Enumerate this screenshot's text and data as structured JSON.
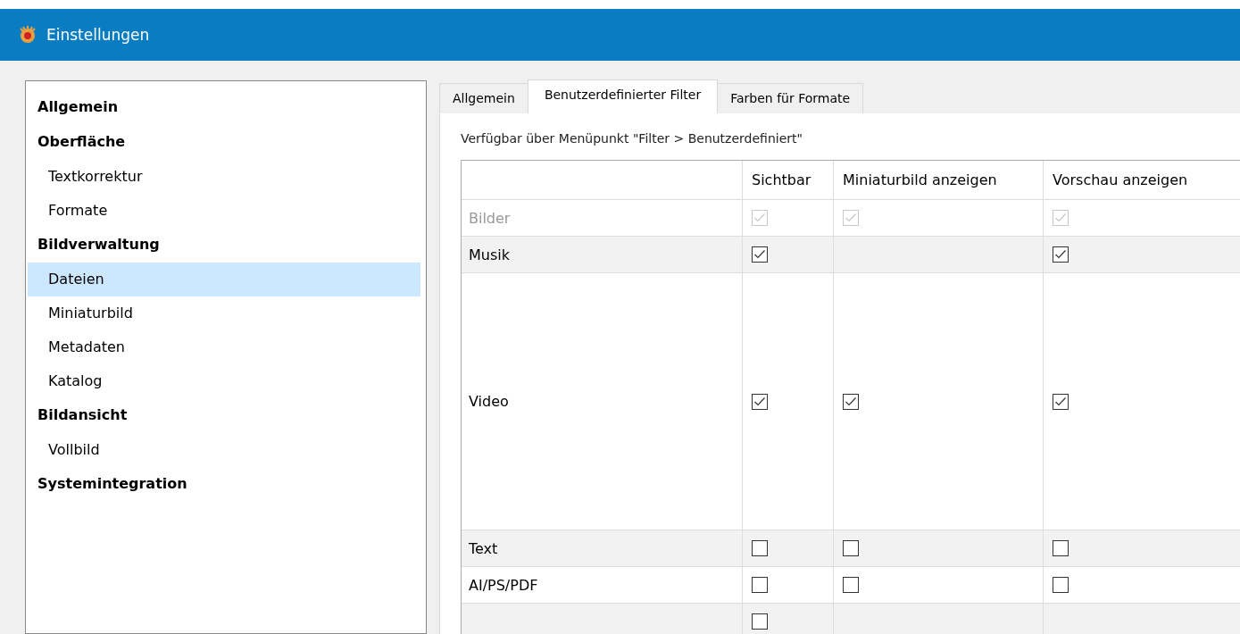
{
  "window": {
    "title": "Einstellungen"
  },
  "sidebar": {
    "items": [
      {
        "label": "Allgemein",
        "selected": false
      },
      {
        "label": "Oberfläche",
        "selected": false,
        "children": [
          {
            "label": "Textkorrektur",
            "selected": false
          },
          {
            "label": "Formate",
            "selected": false
          }
        ]
      },
      {
        "label": "Bildverwaltung",
        "selected": false,
        "children": [
          {
            "label": "Dateien",
            "selected": true
          },
          {
            "label": "Miniaturbild",
            "selected": false
          },
          {
            "label": "Metadaten",
            "selected": false
          },
          {
            "label": "Katalog",
            "selected": false
          }
        ]
      },
      {
        "label": "Bildansicht",
        "selected": false,
        "children": [
          {
            "label": "Vollbild",
            "selected": false
          }
        ]
      },
      {
        "label": "Systemintegration",
        "selected": false
      }
    ]
  },
  "tabs": [
    {
      "label": "Allgemein",
      "selected": false
    },
    {
      "label": "Benutzerdefinierter Filter",
      "selected": true
    },
    {
      "label": "Farben für Formate",
      "selected": false
    }
  ],
  "description": "Verfügbar über Menüpunkt \"Filter > Benutzerdefiniert\"",
  "table": {
    "columns": [
      "Sichtbar",
      "Miniaturbild anzeigen",
      "Vorschau anzeigen"
    ],
    "rows": [
      {
        "label": "Bilder",
        "disabled": true,
        "cells": [
          {
            "kind": "checkbox",
            "checked": true
          },
          {
            "kind": "checkbox",
            "checked": true
          },
          {
            "kind": "checkbox",
            "checked": true
          }
        ]
      },
      {
        "label": "Musik",
        "disabled": false,
        "cells": [
          {
            "kind": "checkbox",
            "checked": true
          },
          {
            "kind": "empty"
          },
          {
            "kind": "checkbox",
            "checked": true
          }
        ]
      },
      {
        "label": "Video",
        "disabled": false,
        "cells": [
          {
            "kind": "checkbox",
            "checked": true
          },
          {
            "kind": "checkbox",
            "checked": true
          },
          {
            "kind": "checkbox",
            "checked": true
          }
        ]
      },
      {
        "label": "Text",
        "disabled": false,
        "cells": [
          {
            "kind": "checkbox",
            "checked": false
          },
          {
            "kind": "checkbox",
            "checked": false
          },
          {
            "kind": "checkbox",
            "checked": false
          }
        ]
      },
      {
        "label": "AI/PS/PDF",
        "disabled": false,
        "cells": [
          {
            "kind": "checkbox",
            "checked": false
          },
          {
            "kind": "checkbox",
            "checked": false
          },
          {
            "kind": "checkbox",
            "checked": false
          }
        ]
      },
      {
        "disabled": false,
        "cells": [
          {
            "kind": "checkbox",
            "checked": false
          },
          {
            "kind": "empty"
          },
          {
            "kind": "empty"
          }
        ]
      }
    ]
  }
}
